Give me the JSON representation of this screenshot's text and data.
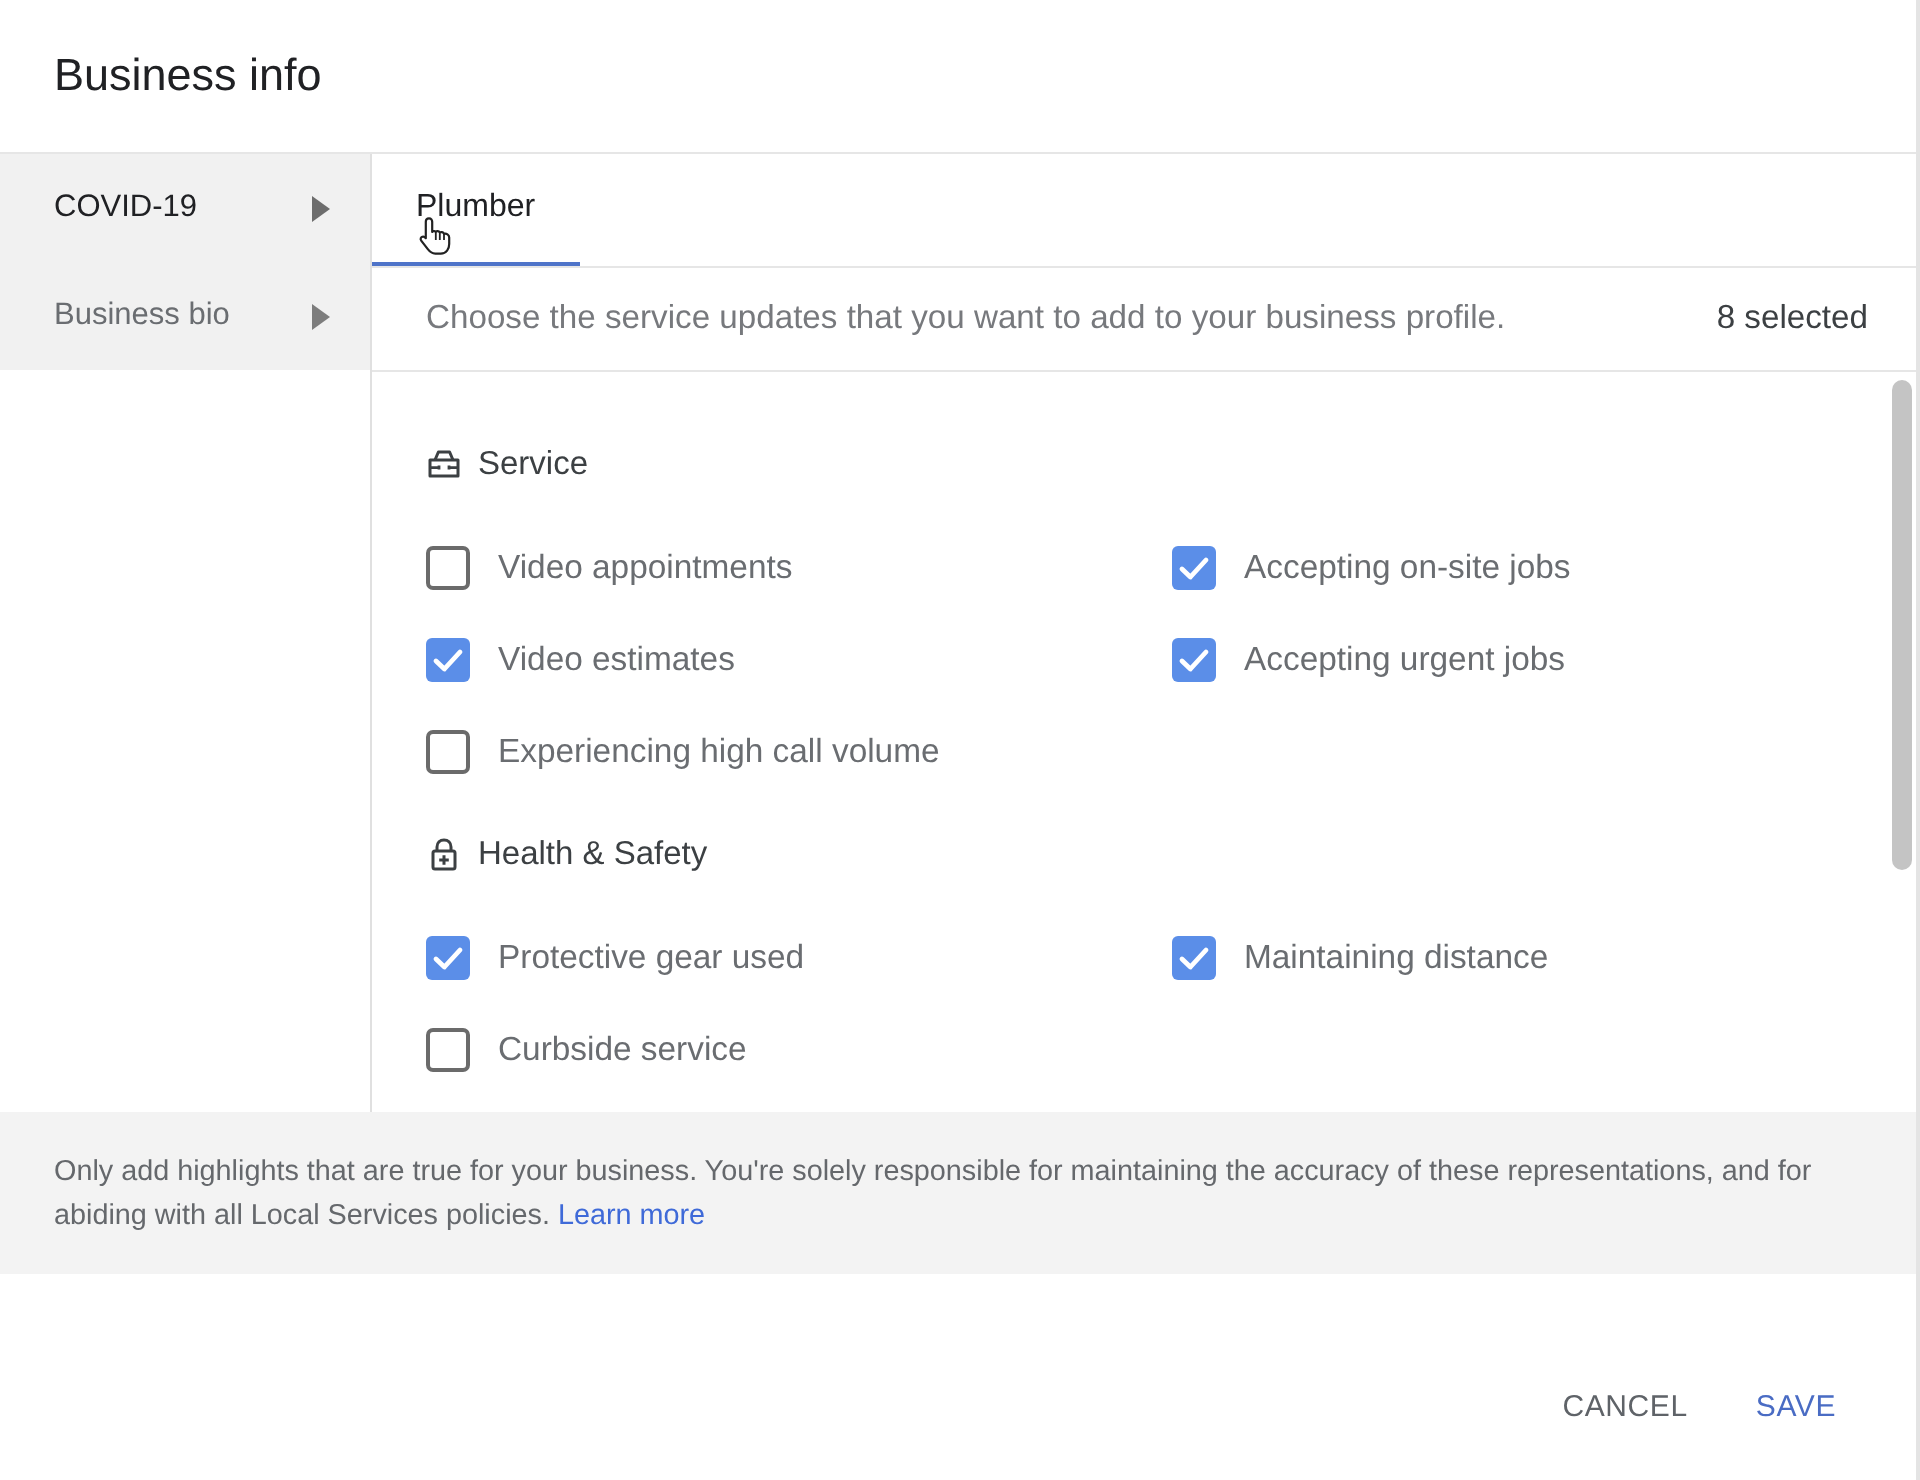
{
  "dialog": {
    "title": "Business info"
  },
  "sidebar": {
    "items": [
      {
        "label": "COVID-19",
        "selected": true
      },
      {
        "label": "Business bio",
        "selected": false
      }
    ]
  },
  "tabs": [
    {
      "label": "Plumber",
      "selected": true
    }
  ],
  "instructions": {
    "text": "Choose the service updates that you want to add to your business profile.",
    "count": "8 selected"
  },
  "sections": [
    {
      "title": "Service",
      "options": [
        {
          "label": "Video appointments",
          "checked": false
        },
        {
          "label": "Accepting on-site jobs",
          "checked": true
        },
        {
          "label": "Video estimates",
          "checked": true
        },
        {
          "label": "Accepting urgent jobs",
          "checked": true
        },
        {
          "label": "Experiencing high call volume",
          "checked": false
        }
      ]
    },
    {
      "title": "Health & Safety",
      "options": [
        {
          "label": "Protective gear used",
          "checked": true
        },
        {
          "label": "Maintaining distance",
          "checked": true
        },
        {
          "label": "Curbside service",
          "checked": false
        }
      ]
    }
  ],
  "notice": {
    "text": "Only add highlights that are true for your business. You're solely responsible for maintaining the accuracy of these representations, and for abiding with all Local Services policies.",
    "link": "Learn more"
  },
  "buttons": [
    {
      "label": "CANCEL",
      "kind": "text"
    },
    {
      "label": "SAVE",
      "kind": "primary"
    }
  ]
}
